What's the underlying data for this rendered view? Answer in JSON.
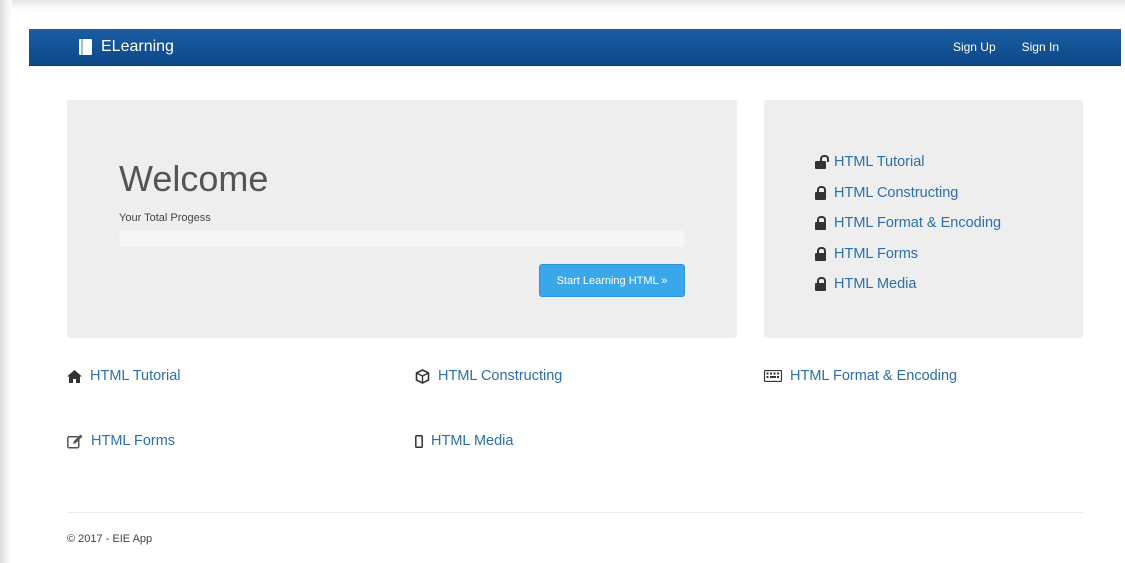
{
  "navbar": {
    "brand_label": "ELearning",
    "brand_icon": "book-icon",
    "sign_up_label": "Sign Up",
    "sign_in_label": "Sign In",
    "bg_color": "#0f4c8d"
  },
  "jumbotron": {
    "heading": "Welcome",
    "progress_label": "Your Total Progess",
    "progress_value": 0,
    "start_button_label": "Start Learning HTML »",
    "button_color": "#3aa7ea"
  },
  "side_panel": {
    "items": [
      {
        "label": "HTML Tutorial",
        "icon": "unlock-icon"
      },
      {
        "label": "HTML Constructing",
        "icon": "lock-icon"
      },
      {
        "label": "HTML Format & Encoding",
        "icon": "lock-icon"
      },
      {
        "label": "HTML Forms",
        "icon": "lock-icon"
      },
      {
        "label": "HTML Media",
        "icon": "lock-icon"
      }
    ]
  },
  "links": [
    {
      "label": "HTML Tutorial",
      "icon": "home-icon"
    },
    {
      "label": "HTML Constructing",
      "icon": "cube-icon"
    },
    {
      "label": "HTML Format & Encoding",
      "icon": "keyboard-icon"
    },
    {
      "label": "HTML Forms",
      "icon": "edit-icon"
    },
    {
      "label": "HTML Media",
      "icon": "mobile-icon"
    }
  ],
  "footer": {
    "text": "© 2017 - EIE App"
  },
  "colors": {
    "link": "#2b6fb0",
    "panel_bg": "#eeeeee"
  }
}
